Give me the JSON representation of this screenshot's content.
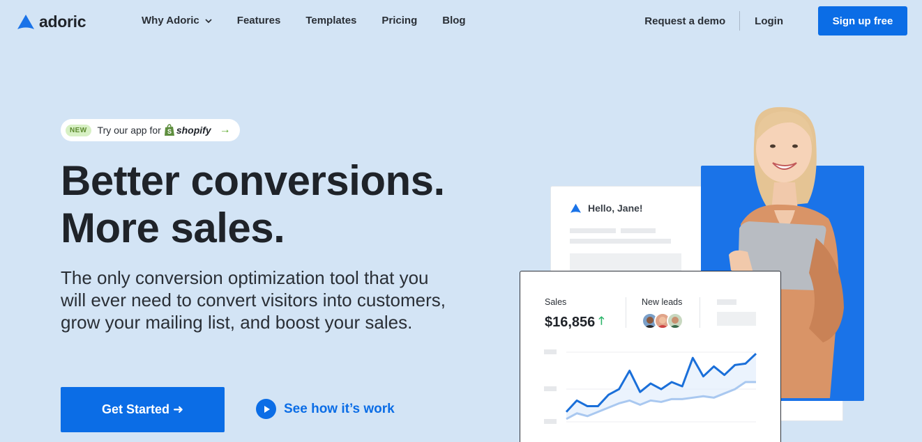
{
  "nav": {
    "logo_text": "adoric",
    "links": [
      "Why Adoric",
      "Features",
      "Templates",
      "Pricing",
      "Blog"
    ],
    "request_demo": "Request a demo",
    "login": "Login",
    "signup": "Sign up free"
  },
  "badge": {
    "new": "NEW",
    "text": "Try our app for",
    "platform": "shopify",
    "arrow": "→"
  },
  "hero": {
    "headline_line1": "Better conversions.",
    "headline_line2": "More sales.",
    "subcopy": "The only conversion optimization tool that you will ever need to convert visitors into customers, grow your mailing list, and boost your sales.",
    "cta": "Get Started ➜",
    "video_link": "See how it’s work"
  },
  "illustration": {
    "greeting": "Hello, Jane!",
    "sales_label": "Sales",
    "sales_value": "$16,856",
    "sales_arrow": "🡑",
    "leads_label": "New leads"
  },
  "chart_data": {
    "type": "line",
    "x": [
      0,
      1,
      2,
      3,
      4,
      5,
      6,
      7,
      8,
      9,
      10,
      11,
      12,
      13,
      14,
      15,
      16,
      17,
      18
    ],
    "series": [
      {
        "values": [
          14,
          30,
          22,
          22,
          38,
          46,
          72,
          42,
          54,
          46,
          56,
          50,
          90,
          64,
          78,
          66,
          80,
          82,
          96
        ]
      },
      {
        "values": [
          4,
          12,
          8,
          14,
          20,
          26,
          30,
          24,
          30,
          28,
          32,
          32,
          34,
          36,
          34,
          40,
          46,
          56,
          56
        ]
      }
    ],
    "colors": [
      "#1a6fd9",
      "#a9c8f0"
    ],
    "ylim": [
      0,
      100
    ],
    "grid": true
  },
  "colors": {
    "brand": "#0b6de6",
    "background": "#d3e4f5"
  }
}
